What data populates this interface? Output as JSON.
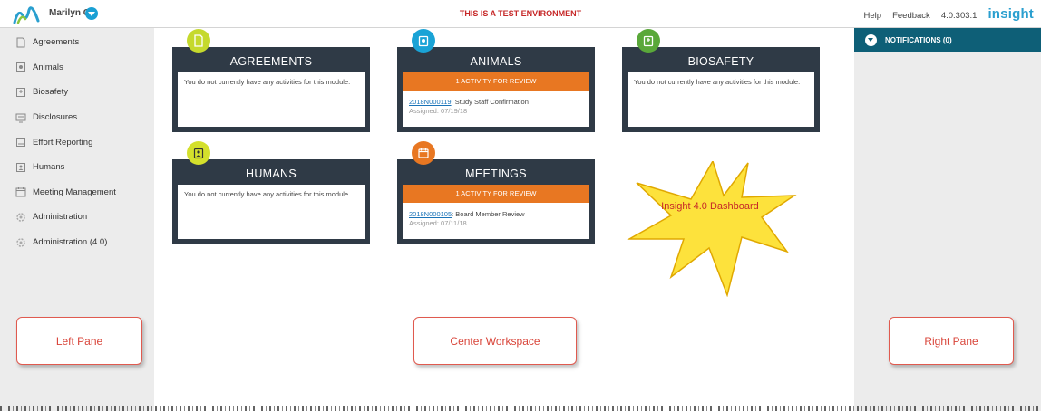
{
  "header": {
    "user_name": "Marilyn G",
    "environment_banner": "THIS IS A TEST ENVIRONMENT",
    "help_label": "Help",
    "feedback_label": "Feedback",
    "version": "4.0.303.1",
    "brand": "insight"
  },
  "sidebar": {
    "items": [
      {
        "label": "Agreements",
        "icon": "document-icon"
      },
      {
        "label": "Animals",
        "icon": "animal-icon"
      },
      {
        "label": "Biosafety",
        "icon": "biosafety-icon"
      },
      {
        "label": "Disclosures",
        "icon": "disclosure-icon"
      },
      {
        "label": "Effort Reporting",
        "icon": "report-icon"
      },
      {
        "label": "Humans",
        "icon": "person-badge-icon"
      },
      {
        "label": "Meeting Management",
        "icon": "calendar-icon"
      },
      {
        "label": "Administration",
        "icon": "gear-icon"
      },
      {
        "label": "Administration (4.0)",
        "icon": "gear-icon"
      }
    ]
  },
  "cards": {
    "agreements": {
      "title": "AGREEMENTS",
      "message": "You do not currently have any activities for this module.",
      "color": "#c5d92d",
      "icon": "document-icon"
    },
    "animals": {
      "title": "ANIMALS",
      "band": "1 ACTIVITY FOR REVIEW",
      "activity_id": "2018N000119",
      "activity_text": ": Study Staff Confirmation",
      "assigned": "Assigned: 07/19/18",
      "color": "#1aa3d6",
      "icon": "animal-icon"
    },
    "biosafety": {
      "title": "BIOSAFETY",
      "message": "You do not currently have any activities for this module.",
      "color": "#5aa83a",
      "icon": "biosafety-icon"
    },
    "humans": {
      "title": "HUMANS",
      "message": "You do not currently have any activities for this module.",
      "color": "#d4e02c",
      "icon": "person-badge-icon"
    },
    "meetings": {
      "title": "MEETINGS",
      "band": "1 ACTIVITY FOR REVIEW",
      "activity_id": "2018N000105",
      "activity_text": ": Board Member Review",
      "assigned": "Assigned: 07/11/18",
      "color": "#e87722",
      "icon": "calendar-icon"
    }
  },
  "notifications": {
    "label": "NOTIFICATIONS (0)"
  },
  "annotations": {
    "starburst": "Insight 4.0 Dashboard",
    "left_pane": "Left Pane",
    "center_workspace": "Center Workspace",
    "right_pane": "Right Pane"
  },
  "colors": {
    "accent_orange": "#e87722",
    "card_dark": "#2f3a46",
    "notif_teal": "#0e5f77",
    "banner_red": "#c62828",
    "brand_blue": "#2a9fcf"
  }
}
